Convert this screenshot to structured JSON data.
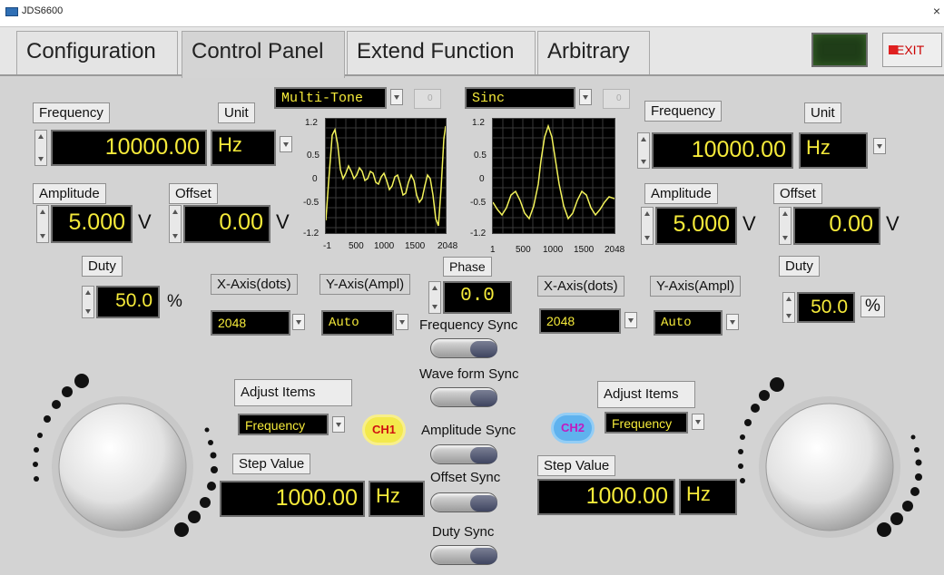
{
  "window": {
    "title": "JDS6600",
    "close": "×"
  },
  "tabs": [
    "Configuration",
    "Control Panel",
    "Extend Function",
    "Arbitrary"
  ],
  "exit_label": "EXIT",
  "ch1": {
    "waveform": "Multi-Tone",
    "frequency_label": "Frequency",
    "unit_label": "Unit",
    "frequency": "10000.00",
    "unit": "Hz",
    "amplitude_label": "Amplitude",
    "amplitude": "5.000",
    "amplitude_unit": "V",
    "offset_label": "Offset",
    "offset": "0.00",
    "offset_unit": "V",
    "duty_label": "Duty",
    "duty": "50.0",
    "duty_unit": "%",
    "xaxis_label": "X-Axis(dots)",
    "xaxis": "2048",
    "yaxis_label": "Y-Axis(Ampl)",
    "yaxis": "Auto",
    "adjust_label": "Adjust Items",
    "adjust": "Frequency",
    "badge": "CH1",
    "step_label": "Step Value",
    "step": "1000.00",
    "step_unit": "Hz"
  },
  "ch2": {
    "waveform": "Sinc",
    "frequency_label": "Frequency",
    "unit_label": "Unit",
    "frequency": "10000.00",
    "unit": "Hz",
    "amplitude_label": "Amplitude",
    "amplitude": "5.000",
    "amplitude_unit": "V",
    "offset_label": "Offset",
    "offset": "0.00",
    "offset_unit": "V",
    "duty_label": "Duty",
    "duty": "50.0",
    "duty_unit": "%",
    "xaxis_label": "X-Axis(dots)",
    "xaxis": "2048",
    "yaxis_label": "Y-Axis(Ampl)",
    "yaxis": "Auto",
    "adjust_label": "Adjust Items",
    "adjust": "Frequency",
    "badge": "CH2",
    "step_label": "Step Value",
    "step": "1000.00",
    "step_unit": "Hz"
  },
  "center": {
    "phase_label": "Phase",
    "phase": "0.0",
    "sync": [
      "Frequency Sync",
      "Wave form Sync",
      "Amplitude Sync",
      "Offset Sync",
      "Duty  Sync"
    ]
  },
  "spin_zero": "0",
  "scope1": {
    "y_ticks": [
      "1.2",
      "0.5",
      "0",
      "-0.5",
      "-1.2"
    ],
    "x_ticks": [
      "-1",
      "500",
      "1000",
      "1500",
      "2048"
    ]
  },
  "scope2": {
    "y_ticks": [
      "1.2",
      "0.5",
      "0",
      "-0.5",
      "-1.2"
    ],
    "x_ticks": [
      "1",
      "500",
      "1000",
      "1500",
      "2048"
    ]
  },
  "colors": {
    "display_bg": "#000000",
    "display_text": "#f5ea3a",
    "trace": "#f2f25a",
    "panel": "#d3d3d3"
  }
}
